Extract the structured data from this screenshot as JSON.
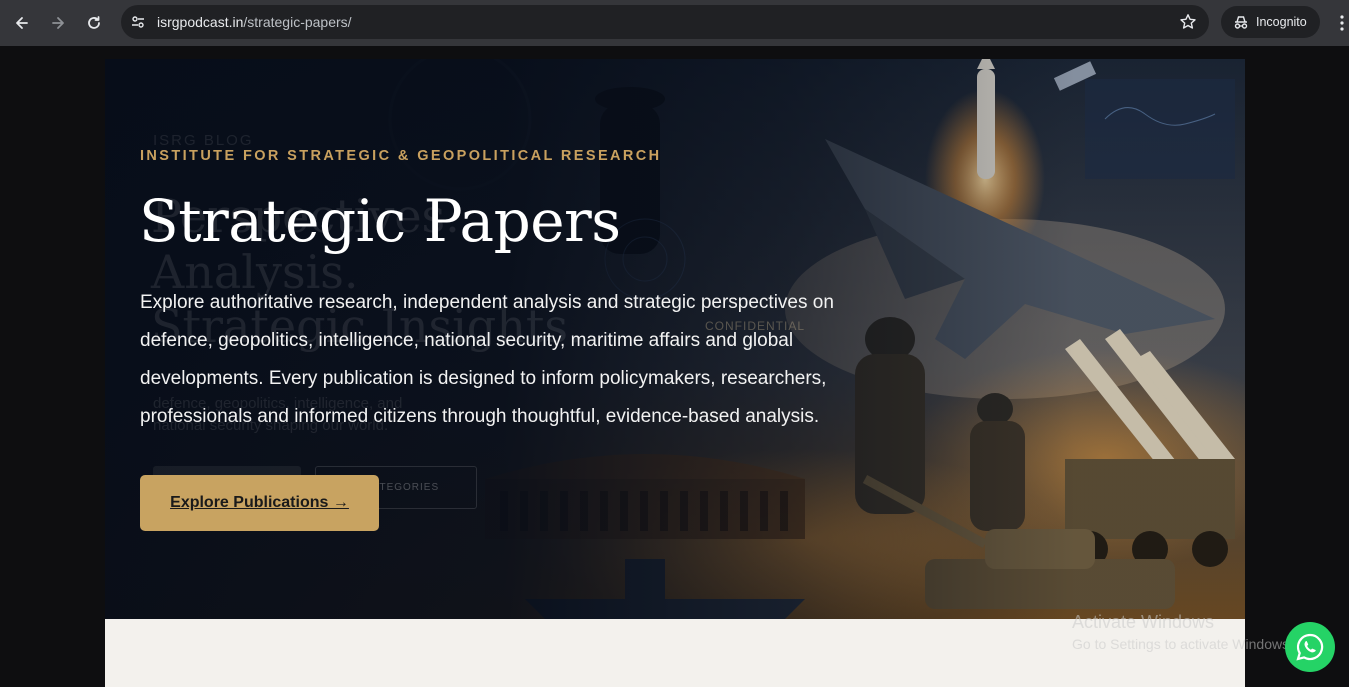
{
  "browser": {
    "url_host": "isrgpodcast.in",
    "url_path": "/strategic-papers/",
    "incognito_label": "Incognito",
    "icons": [
      "back-icon",
      "forward-icon",
      "reload-icon",
      "site-info-icon",
      "bookmark-star-icon",
      "incognito-icon",
      "menu-dots-icon"
    ]
  },
  "hero": {
    "eyebrow": "INSTITUTE FOR STRATEGIC & GEOPOLITICAL RESEARCH",
    "title": "Strategic Papers",
    "description": "Explore authoritative research, independent analysis and strategic perspectives on defence, geopolitics, intelligence, national security, maritime affairs and global developments. Every publication is designed to inform policymakers, researchers, professionals and informed citizens through thoughtful, evidence-based analysis.",
    "cta_label": "Explore Publications →",
    "ghost": {
      "blog_label": "ISRG BLOG",
      "line1": "Perspectives.",
      "line2": "Analysis.",
      "line3": "Strategic Insights.",
      "sub1": "defence, geopolitics, intelligence, and",
      "sub2": "national security shaping our world.",
      "button": "E CATEGORIES",
      "stamp": "CONFIDENTIAL"
    }
  },
  "watermark": {
    "line1": "Activate Windows",
    "line2": "Go to Settings to activate Windows."
  },
  "colors": {
    "accent_gold": "#c8a361",
    "eyebrow_gold": "#c9a15f",
    "hero_dark": "#0a1120",
    "whatsapp": "#25d366"
  }
}
